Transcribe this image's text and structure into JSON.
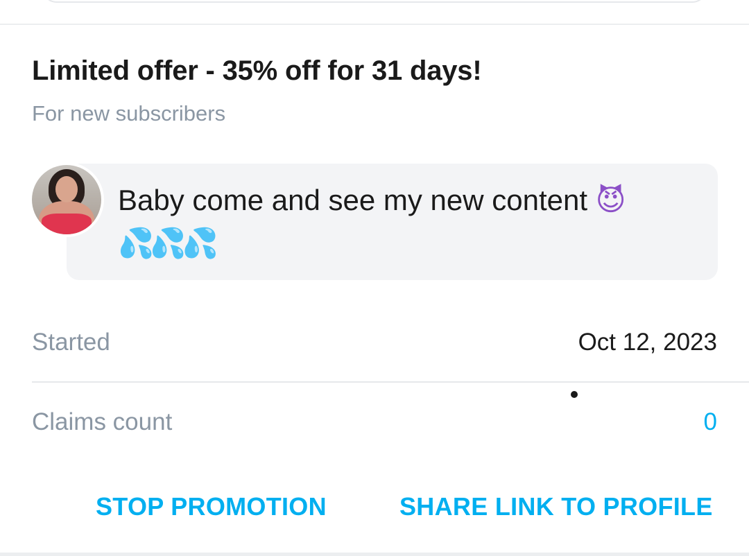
{
  "offer": {
    "title": "Limited offer - 35% off for 31 days!",
    "subtitle": "For new subscribers"
  },
  "message": {
    "text": "Baby come and see my new content ",
    "emoji_devil": "😈",
    "emoji_drops": "💦💦💦"
  },
  "details": {
    "started_label": "Started",
    "started_value": "Oct 12, 2023",
    "claims_label": "Claims count",
    "claims_value": "0"
  },
  "actions": {
    "stop_label": "STOP PROMOTION",
    "share_label": "SHARE LINK TO PROFILE"
  },
  "colors": {
    "accent": "#00aff0",
    "muted_text": "#8a96a3",
    "primary_text": "#1a1a1a",
    "bubble_bg": "#f3f4f6"
  },
  "icons": {
    "avatar": "avatar-photo",
    "emoji_devil": "smiling-face-with-horns-icon",
    "emoji_drops": "sweat-droplets-icon"
  }
}
